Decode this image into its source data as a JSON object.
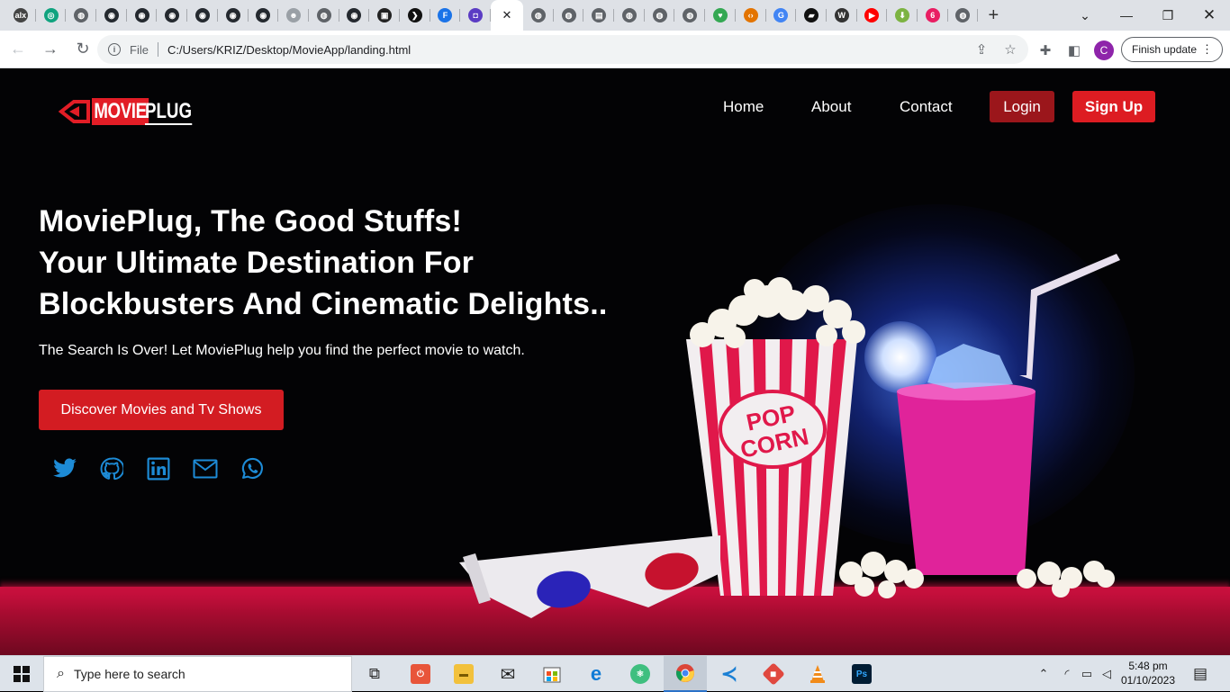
{
  "browser": {
    "tabs": [
      {
        "icon": "alx-icon",
        "color": "#444444",
        "glyph": "alx"
      },
      {
        "icon": "openai-icon",
        "color": "#10a37f",
        "glyph": "◎"
      },
      {
        "icon": "globe-icon",
        "color": "#5f6368",
        "glyph": "◍"
      },
      {
        "icon": "github-icon",
        "color": "#24292f",
        "glyph": "◉"
      },
      {
        "icon": "github-icon",
        "color": "#24292f",
        "glyph": "◉"
      },
      {
        "icon": "github-icon",
        "color": "#24292f",
        "glyph": "◉"
      },
      {
        "icon": "github-icon",
        "color": "#24292f",
        "glyph": "◉"
      },
      {
        "icon": "github-icon",
        "color": "#24292f",
        "glyph": "◉"
      },
      {
        "icon": "github-icon",
        "color": "#24292f",
        "glyph": "◉"
      },
      {
        "icon": "reddit-icon",
        "color": "#9aa0a6",
        "glyph": "☻"
      },
      {
        "icon": "globe-icon",
        "color": "#5f6368",
        "glyph": "◍"
      },
      {
        "icon": "github-icon",
        "color": "#24292f",
        "glyph": "◉"
      },
      {
        "icon": "film-icon",
        "color": "#222222",
        "glyph": "▣"
      },
      {
        "icon": "plex-icon",
        "color": "#111111",
        "glyph": "❯"
      },
      {
        "icon": "flutter-icon",
        "color": "#1a73e8",
        "glyph": "F"
      },
      {
        "icon": "shield-icon",
        "color": "#5b3cc4",
        "glyph": "◘"
      },
      {
        "icon": "close-icon",
        "color": "#202124",
        "glyph": "✕",
        "active": true
      },
      {
        "icon": "globe-icon",
        "color": "#5f6368",
        "glyph": "◍"
      },
      {
        "icon": "globe-icon",
        "color": "#5f6368",
        "glyph": "◍"
      },
      {
        "icon": "document-icon",
        "color": "#5f6368",
        "glyph": "▤"
      },
      {
        "icon": "globe-icon",
        "color": "#5f6368",
        "glyph": "◍"
      },
      {
        "icon": "globe-icon",
        "color": "#5f6368",
        "glyph": "◍"
      },
      {
        "icon": "globe-icon",
        "color": "#5f6368",
        "glyph": "◍"
      },
      {
        "icon": "pin-icon",
        "color": "#34a853",
        "glyph": "♥"
      },
      {
        "icon": "code-icon",
        "color": "#e37400",
        "glyph": "‹›"
      },
      {
        "icon": "google-icon",
        "color": "#4285f4",
        "glyph": "G"
      },
      {
        "icon": "terminal-icon",
        "color": "#111111",
        "glyph": "▰"
      },
      {
        "icon": "wikipedia-icon",
        "color": "#333333",
        "glyph": "W"
      },
      {
        "icon": "youtube-icon",
        "color": "#ff0000",
        "glyph": "▶"
      },
      {
        "icon": "download-icon",
        "color": "#7cb342",
        "glyph": "⬇"
      },
      {
        "icon": "app-icon",
        "color": "#e91e63",
        "glyph": "6"
      },
      {
        "icon": "globe-icon",
        "color": "#5f6368",
        "glyph": "◍"
      }
    ],
    "new_tab": "+",
    "address": {
      "scheme": "File",
      "url": "C:/Users/KRIZ/Desktop/MovieApp/landing.html"
    },
    "profile_initial": "C",
    "update_label": "Finish update"
  },
  "site": {
    "brand": {
      "part1": "MOVIE",
      "part2": "PLUG"
    },
    "nav": [
      "Home",
      "About",
      "Contact"
    ],
    "login": "Login",
    "signup": "Sign Up",
    "headline": [
      "MoviePlug, The Good Stuffs!",
      "Your Ultimate Destination For",
      "Blockbusters And Cinematic Delights.."
    ],
    "subline": "The Search Is Over! Let MoviePlug help you find the perfect movie to watch.",
    "cta": "Discover Movies and Tv Shows",
    "social_icons": [
      "twitter-icon",
      "github-icon",
      "linkedin-icon",
      "mail-icon",
      "whatsapp-icon"
    ],
    "colors": {
      "accent": "#dd1c22",
      "login_bg": "#9b161b",
      "social": "#1d8bd6"
    }
  },
  "taskbar": {
    "search_placeholder": "Type here to search",
    "apps": [
      "task-view-icon",
      "app-icon",
      "file-explorer-icon",
      "mail-icon",
      "store-icon",
      "edge-icon",
      "react-icon",
      "chrome-icon",
      "vscode-icon",
      "git-icon",
      "vlc-icon",
      "photoshop-icon"
    ],
    "ps_label": "Ps",
    "time": "5:48 pm",
    "date": "01/10/2023"
  }
}
